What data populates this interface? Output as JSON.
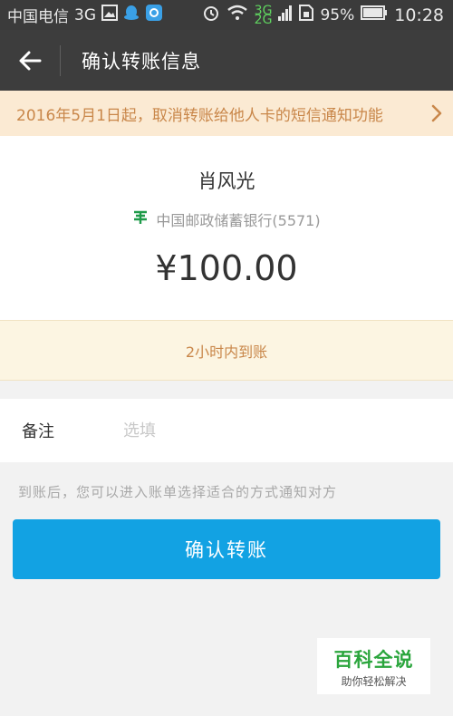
{
  "status_bar": {
    "carrier": "中国电信",
    "network": "3G",
    "signal_tag_top": "3G",
    "signal_tag_bottom": "2G",
    "battery": "95%",
    "time": "10:28"
  },
  "toolbar": {
    "title": "确认转账信息"
  },
  "notice": {
    "text": "2016年5月1日起，取消转账给他人卡的短信通知功能"
  },
  "transfer": {
    "payee_name": "肖风光",
    "bank_name": "中国邮政储蓄银行(5571)",
    "amount": "¥100.00"
  },
  "arrival": {
    "text": "2小时内到账"
  },
  "remark": {
    "label": "备注",
    "placeholder": "选填",
    "value": ""
  },
  "hint": {
    "text": "到账后，您可以进入账单选择适合的方式通知对方"
  },
  "confirm_button": {
    "label": "确认转账"
  },
  "watermark": {
    "title": "百科全说",
    "subtitle": "助你轻松解决"
  },
  "colors": {
    "accent": "#12a2e3",
    "notice_text": "#c9874a",
    "toolbar_bg": "#3d3d3d",
    "watermark_green": "#2aa53c"
  }
}
